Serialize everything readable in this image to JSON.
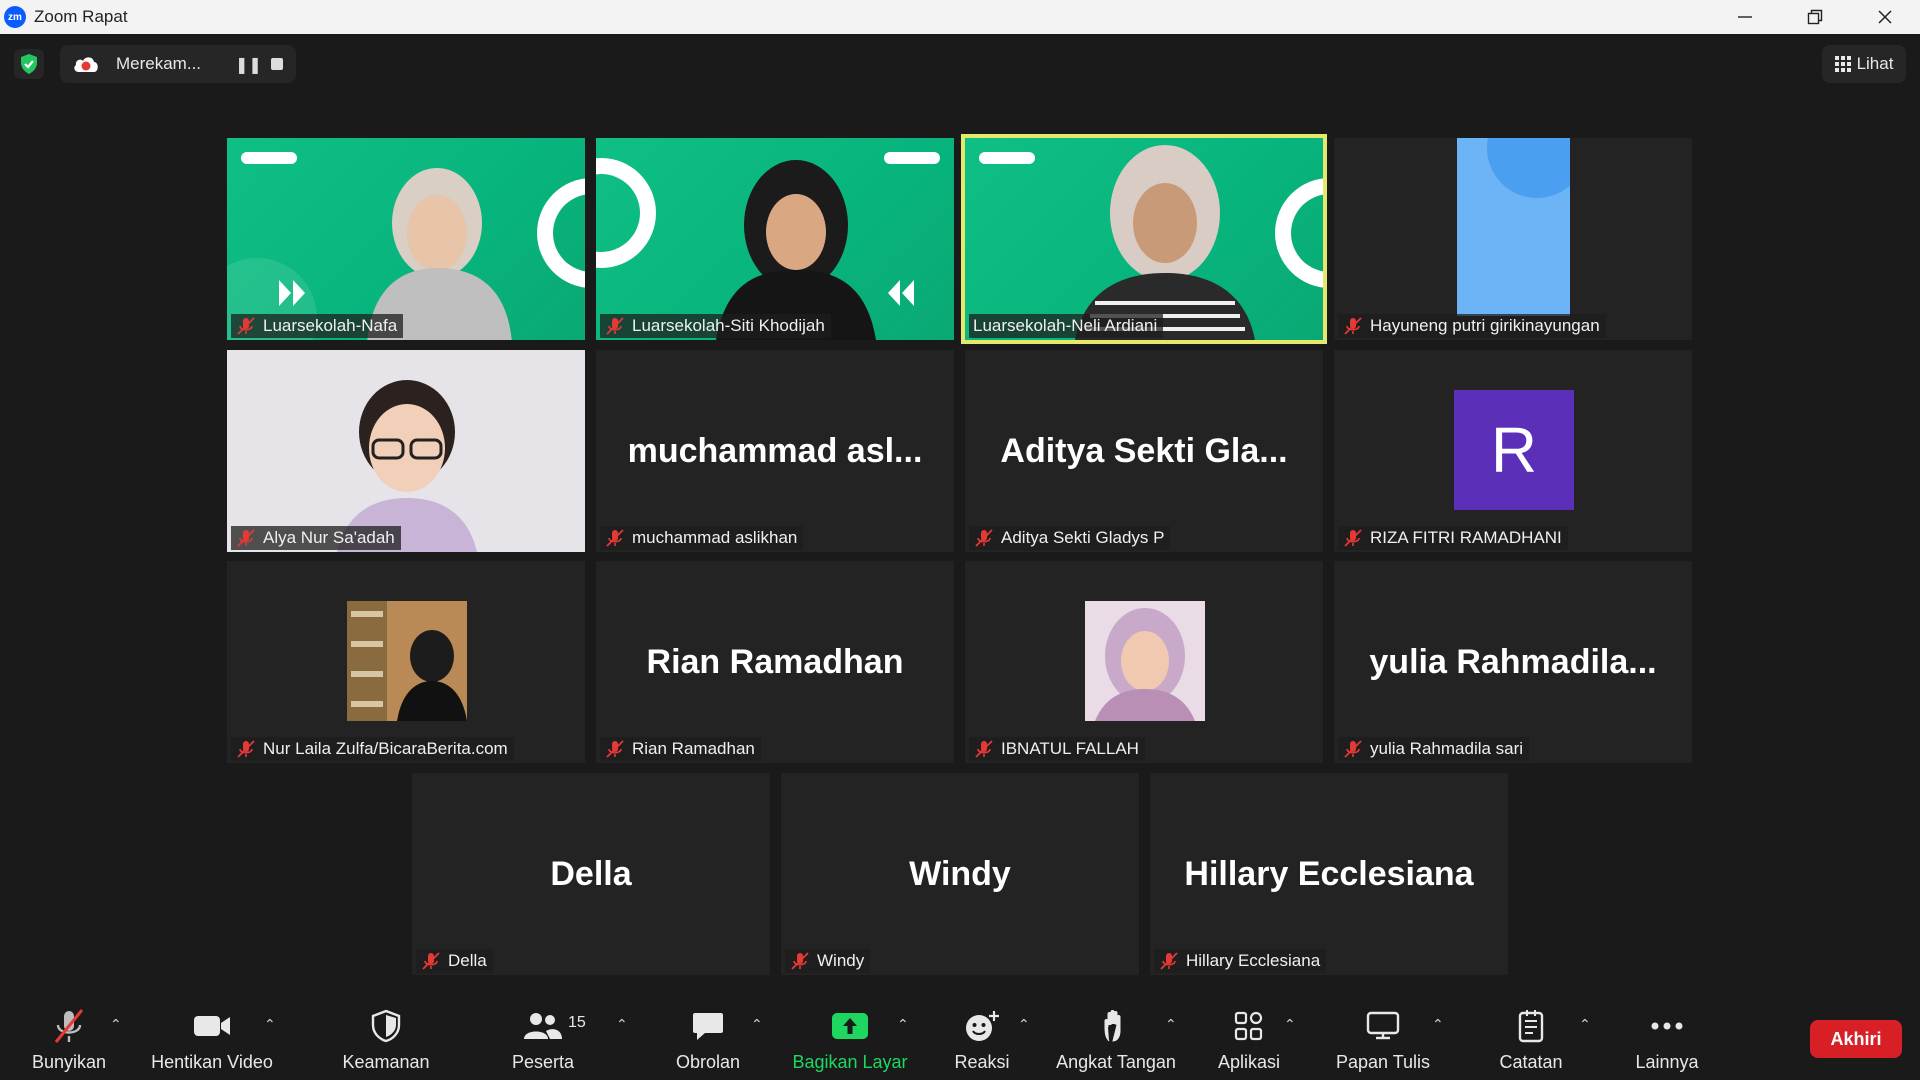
{
  "window": {
    "app_icon_text": "zm",
    "title": "Zoom Rapat"
  },
  "topbar": {
    "recording_label": "Merekam...",
    "view_label": "Lihat"
  },
  "participants": [
    {
      "name": "Luarsekolah-Nafa",
      "display": "",
      "muted": true
    },
    {
      "name": "Luarsekolah-Siti Khodijah",
      "display": "",
      "muted": true
    },
    {
      "name": "Luarsekolah-Neli Ardiani",
      "display": "",
      "muted": false,
      "active_speaker": true
    },
    {
      "name": "Hayuneng putri girikinayungan",
      "display": "",
      "muted": true
    },
    {
      "name": "Alya Nur Sa'adah",
      "display": "",
      "muted": true
    },
    {
      "name": "muchammad aslikhan",
      "display": "muchammad asl...",
      "muted": true
    },
    {
      "name": "Aditya Sekti Gladys P",
      "display": "Aditya Sekti Gla...",
      "muted": true
    },
    {
      "name": "RIZA FITRI RAMADHANI",
      "display": "R",
      "muted": true
    },
    {
      "name": "Nur Laila Zulfa/BicaraBerita.com",
      "display": "",
      "muted": true
    },
    {
      "name": "Rian Ramadhan",
      "display": "Rian Ramadhan",
      "muted": true
    },
    {
      "name": "IBNATUL FALLAH",
      "display": "",
      "muted": true
    },
    {
      "name": "yulia Rahmadila sari",
      "display": "yulia Rahmadila...",
      "muted": true
    },
    {
      "name": "Della",
      "display": "Della",
      "muted": true
    },
    {
      "name": "Windy",
      "display": "Windy",
      "muted": true
    },
    {
      "name": "Hillary Ecclesiana",
      "display": "Hillary Ecclesiana",
      "muted": true
    }
  ],
  "toolbar": {
    "unmute": "Bunyikan",
    "stop_video": "Hentikan Video",
    "security": "Keamanan",
    "participants": "Peserta",
    "participants_count": "15",
    "chat": "Obrolan",
    "share_screen": "Bagikan Layar",
    "reactions": "Reaksi",
    "raise_hand": "Angkat Tangan",
    "apps": "Aplikasi",
    "whiteboard": "Papan Tulis",
    "notes": "Catatan",
    "more": "Lainnya",
    "end": "Akhiri"
  },
  "colors": {
    "background": "#1a1a1a",
    "tile": "#232323",
    "active_speaker_border": "#e4e86b",
    "share_green": "#1ed760",
    "end_red": "#d91f26",
    "mute_red": "#e53935"
  }
}
